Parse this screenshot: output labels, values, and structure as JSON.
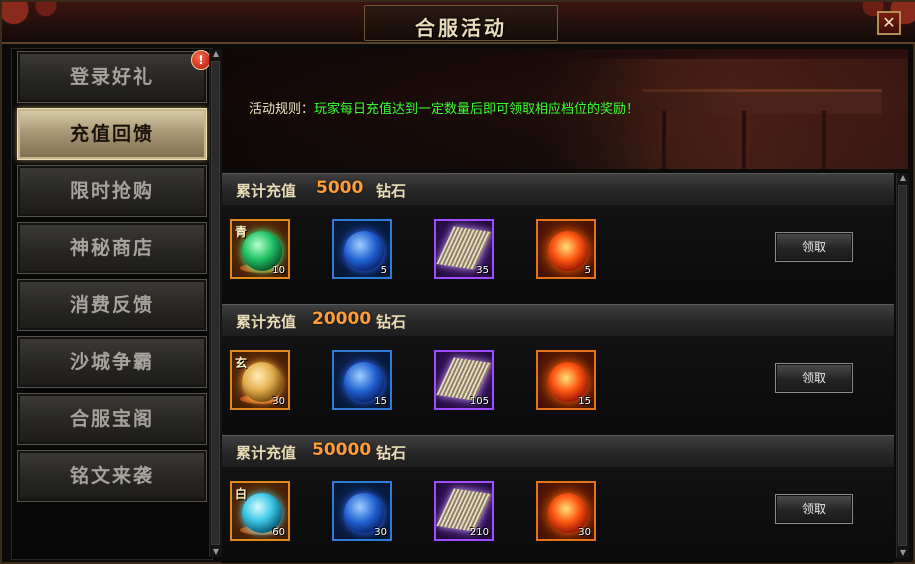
{
  "window": {
    "title": "合服活动"
  },
  "sidebar": {
    "items": [
      {
        "label": "登录好礼"
      },
      {
        "label": "充值回馈",
        "active": true
      },
      {
        "label": "限时抢购"
      },
      {
        "label": "神秘商店"
      },
      {
        "label": "消费反馈"
      },
      {
        "label": "沙城争霸"
      },
      {
        "label": "合服宝阁"
      },
      {
        "label": "铭文来袭"
      }
    ],
    "badge": "!"
  },
  "rules": {
    "label": "活动规则：",
    "text": "玩家每日充值达到一定数量后即可领取相应档位的奖励！"
  },
  "tiers": [
    {
      "label": "累计充值",
      "amount": "5000",
      "unit": "钻石",
      "claim_label": "领取",
      "rewards": [
        {
          "icon": "green-orb-icon",
          "tag": "青",
          "qty": "10"
        },
        {
          "icon": "blue-orb-icon",
          "qty": "5"
        },
        {
          "icon": "scroll-icon",
          "qty": "35"
        },
        {
          "icon": "fire-orb-icon",
          "qty": "5"
        }
      ]
    },
    {
      "label": "累计充值",
      "amount": "20000",
      "unit": "钻石",
      "claim_label": "领取",
      "rewards": [
        {
          "icon": "amber-orb-icon",
          "tag": "玄",
          "qty": "30"
        },
        {
          "icon": "blue-orb-icon",
          "qty": "15"
        },
        {
          "icon": "scroll-icon",
          "qty": "105"
        },
        {
          "icon": "fire-orb-icon",
          "qty": "15"
        }
      ]
    },
    {
      "label": "累计充值",
      "amount": "50000",
      "unit": "钻石",
      "claim_label": "领取",
      "rewards": [
        {
          "icon": "cyan-orb-icon",
          "tag": "白",
          "qty": "60"
        },
        {
          "icon": "blue-orb-icon",
          "qty": "30"
        },
        {
          "icon": "scroll-icon",
          "qty": "210"
        },
        {
          "icon": "fire-orb-icon",
          "qty": "30"
        }
      ]
    }
  ],
  "close_glyph": "✕",
  "colors": {
    "accent": "#ff9c3a",
    "rule_text": "#37ff2d"
  }
}
